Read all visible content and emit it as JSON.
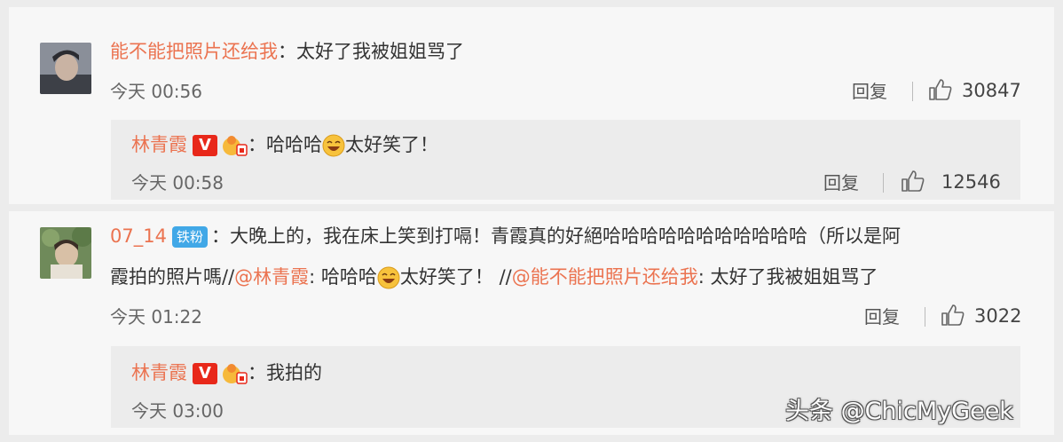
{
  "comments": [
    {
      "username": "能不能把照片还给我",
      "colon": "：",
      "text": "太好了我被姐姐骂了",
      "time": "今天 00:56",
      "reply_label": "回复",
      "likes": "30847",
      "sub_reply": {
        "username": "林青霞",
        "v_badge": "V",
        "colon": "：",
        "text_before_emoji": "哈哈哈",
        "text_after_emoji": "太好笑了！",
        "time": "今天 00:58",
        "reply_label": "回复",
        "likes": "12546"
      }
    },
    {
      "username": "07_14",
      "fan_badge": "铁粉",
      "colon": "：",
      "line1": "大晚上的，我在床上笑到打嗝！青霞真的好絕哈哈哈哈哈哈哈哈哈哈哈（所以是阿",
      "line2_a": "霞拍的照片嗎//",
      "mention1": "@林青霞",
      "line2_b": ": 哈哈哈",
      "line2_c": "太好笑了！ //",
      "mention2": "@能不能把照片还给我",
      "line2_d": ": 太好了我被姐姐骂了",
      "time": "今天 01:22",
      "reply_label": "回复",
      "likes": "3022",
      "sub_reply": {
        "username": "林青霞",
        "v_badge": "V",
        "colon": "：",
        "text": "我拍的",
        "time": "今天 03:00"
      }
    }
  ],
  "watermark": "头条 @ChicMyGeek",
  "colors": {
    "username": "#eb7350",
    "v_badge": "#e8281a",
    "fan_badge": "#41a8e7"
  },
  "icons": [
    "avatar",
    "like-icon",
    "v-badge",
    "fan-medal-icon",
    "laughing-emoji-icon"
  ]
}
